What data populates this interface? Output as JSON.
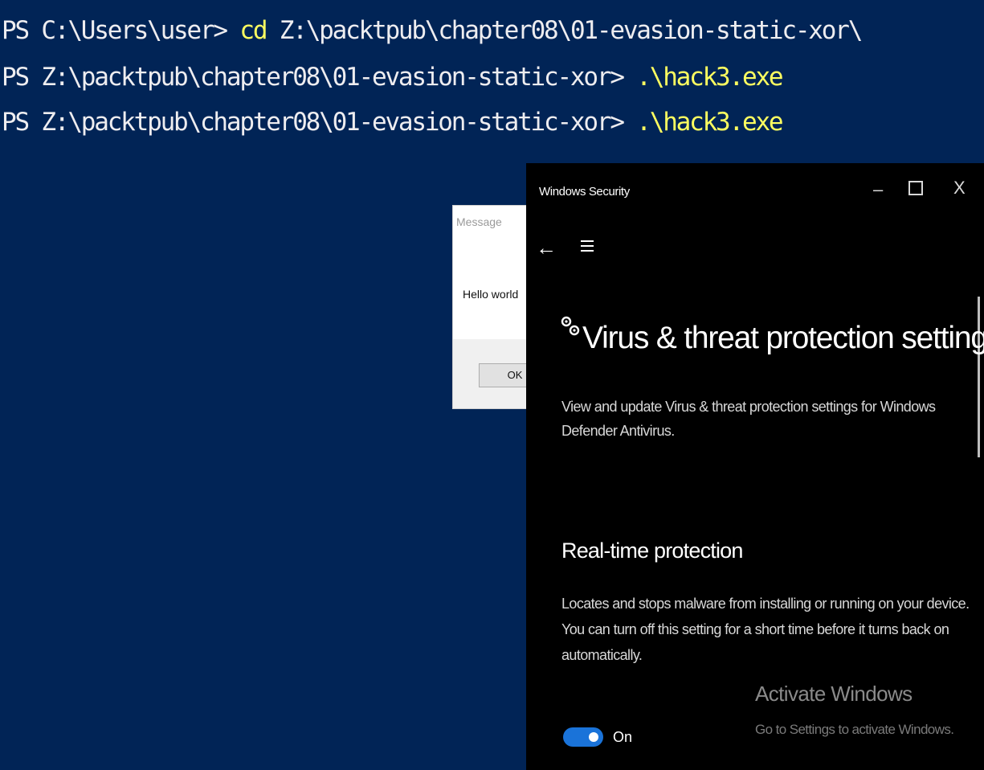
{
  "console": {
    "lines": [
      {
        "prompt": "PS C:\\Users\\user> ",
        "cmd": "cd",
        "rest": " Z:\\packtpub\\chapter08\\01-evasion-static-xor\\"
      },
      {
        "prompt": "PS Z:\\packtpub\\chapter08\\01-evasion-static-xor> ",
        "cmd": ".\\hack3.exe",
        "rest": ""
      },
      {
        "prompt": "PS Z:\\packtpub\\chapter08\\01-evasion-static-xor> ",
        "cmd": ".\\hack3.exe",
        "rest": ""
      }
    ]
  },
  "message_box": {
    "title": "Message",
    "text": "Hello world",
    "ok_label": "OK"
  },
  "windows_security": {
    "title": "Windows Security",
    "minimize": "–",
    "close": "X",
    "back_icon": "back-arrow-icon",
    "menu_icon": "hamburger-menu-icon",
    "heading_icon": "settings-gears-icon",
    "heading": "Virus & threat protection settings",
    "description": "View and update Virus & threat protection settings for Windows Defender Antivirus.",
    "realtime": {
      "title": "Real-time protection",
      "description": "Locates and stops malware from installing or running on your device. You can turn off this setting for a short time before it turns back on automatically.",
      "toggle_state": "On"
    }
  },
  "watermark": {
    "title": "Activate Windows",
    "subtitle": "Go to Settings to activate Windows."
  },
  "colors": {
    "console_bg": "#012456",
    "console_text": "#eeedf0",
    "console_cmd": "#ffff60",
    "toggle_on": "#1a73d9"
  }
}
